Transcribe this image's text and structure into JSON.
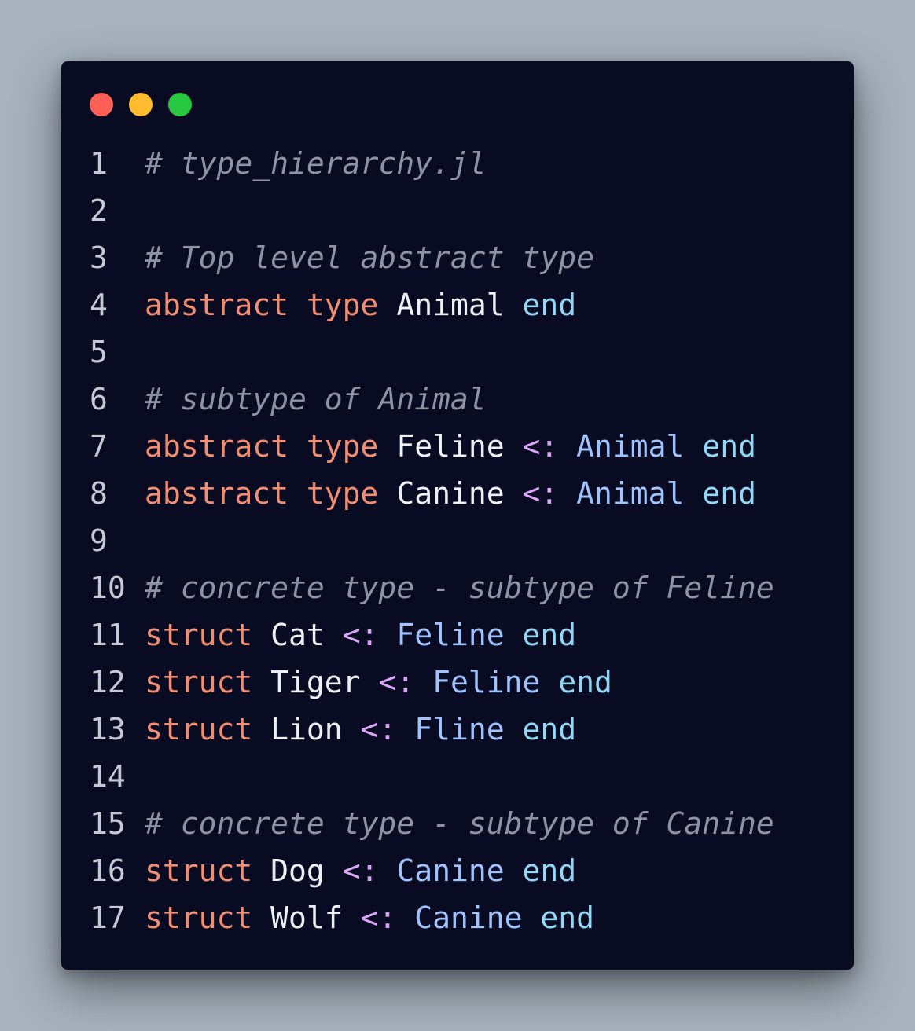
{
  "window": {
    "controls": [
      {
        "name": "close",
        "color": "#fe5f57"
      },
      {
        "name": "minimize",
        "color": "#febc2e"
      },
      {
        "name": "maximize",
        "color": "#28c840"
      }
    ]
  },
  "code": {
    "language": "julia",
    "lines": [
      {
        "number": "1",
        "tokens": [
          {
            "text": "# type_hierarchy.jl",
            "kind": "comment"
          }
        ]
      },
      {
        "number": "2",
        "tokens": []
      },
      {
        "number": "3",
        "tokens": [
          {
            "text": "# Top level abstract type",
            "kind": "comment"
          }
        ]
      },
      {
        "number": "4",
        "tokens": [
          {
            "text": "abstract type",
            "kind": "kw"
          },
          {
            "text": " ",
            "kind": "plain"
          },
          {
            "text": "Animal",
            "kind": "name"
          },
          {
            "text": " ",
            "kind": "plain"
          },
          {
            "text": "end",
            "kind": "end"
          }
        ]
      },
      {
        "number": "5",
        "tokens": []
      },
      {
        "number": "6",
        "tokens": [
          {
            "text": "# subtype of Animal",
            "kind": "comment"
          }
        ]
      },
      {
        "number": "7",
        "tokens": [
          {
            "text": "abstract type",
            "kind": "kw"
          },
          {
            "text": " ",
            "kind": "plain"
          },
          {
            "text": "Feline",
            "kind": "name"
          },
          {
            "text": " ",
            "kind": "plain"
          },
          {
            "text": "<:",
            "kind": "op"
          },
          {
            "text": " ",
            "kind": "plain"
          },
          {
            "text": "Animal",
            "kind": "type"
          },
          {
            "text": " ",
            "kind": "plain"
          },
          {
            "text": "end",
            "kind": "end"
          }
        ]
      },
      {
        "number": "8",
        "tokens": [
          {
            "text": "abstract type",
            "kind": "kw"
          },
          {
            "text": " ",
            "kind": "plain"
          },
          {
            "text": "Canine",
            "kind": "name"
          },
          {
            "text": " ",
            "kind": "plain"
          },
          {
            "text": "<:",
            "kind": "op"
          },
          {
            "text": " ",
            "kind": "plain"
          },
          {
            "text": "Animal",
            "kind": "type"
          },
          {
            "text": " ",
            "kind": "plain"
          },
          {
            "text": "end",
            "kind": "end"
          }
        ]
      },
      {
        "number": "9",
        "tokens": []
      },
      {
        "number": "10",
        "tokens": [
          {
            "text": "# concrete type - subtype of Feline",
            "kind": "comment"
          }
        ]
      },
      {
        "number": "11",
        "tokens": [
          {
            "text": "struct",
            "kind": "kw"
          },
          {
            "text": " ",
            "kind": "plain"
          },
          {
            "text": "Cat",
            "kind": "name"
          },
          {
            "text": " ",
            "kind": "plain"
          },
          {
            "text": "<:",
            "kind": "op"
          },
          {
            "text": " ",
            "kind": "plain"
          },
          {
            "text": "Feline",
            "kind": "type"
          },
          {
            "text": " ",
            "kind": "plain"
          },
          {
            "text": "end",
            "kind": "end"
          }
        ]
      },
      {
        "number": "12",
        "tokens": [
          {
            "text": "struct",
            "kind": "kw"
          },
          {
            "text": " ",
            "kind": "plain"
          },
          {
            "text": "Tiger",
            "kind": "name"
          },
          {
            "text": " ",
            "kind": "plain"
          },
          {
            "text": "<:",
            "kind": "op"
          },
          {
            "text": " ",
            "kind": "plain"
          },
          {
            "text": "Feline",
            "kind": "type"
          },
          {
            "text": " ",
            "kind": "plain"
          },
          {
            "text": "end",
            "kind": "end"
          }
        ]
      },
      {
        "number": "13",
        "tokens": [
          {
            "text": "struct",
            "kind": "kw"
          },
          {
            "text": " ",
            "kind": "plain"
          },
          {
            "text": "Lion",
            "kind": "name"
          },
          {
            "text": " ",
            "kind": "plain"
          },
          {
            "text": "<:",
            "kind": "op"
          },
          {
            "text": " ",
            "kind": "plain"
          },
          {
            "text": "Fline",
            "kind": "type"
          },
          {
            "text": " ",
            "kind": "plain"
          },
          {
            "text": "end",
            "kind": "end"
          }
        ]
      },
      {
        "number": "14",
        "tokens": []
      },
      {
        "number": "15",
        "tokens": [
          {
            "text": "# concrete type - subtype of Canine",
            "kind": "comment"
          }
        ]
      },
      {
        "number": "16",
        "tokens": [
          {
            "text": "struct",
            "kind": "kw"
          },
          {
            "text": " ",
            "kind": "plain"
          },
          {
            "text": "Dog",
            "kind": "name"
          },
          {
            "text": " ",
            "kind": "plain"
          },
          {
            "text": "<:",
            "kind": "op"
          },
          {
            "text": " ",
            "kind": "plain"
          },
          {
            "text": "Canine",
            "kind": "type"
          },
          {
            "text": " ",
            "kind": "plain"
          },
          {
            "text": "end",
            "kind": "end"
          }
        ]
      },
      {
        "number": "17",
        "tokens": [
          {
            "text": "struct",
            "kind": "kw"
          },
          {
            "text": " ",
            "kind": "plain"
          },
          {
            "text": "Wolf",
            "kind": "name"
          },
          {
            "text": " ",
            "kind": "plain"
          },
          {
            "text": "<:",
            "kind": "op"
          },
          {
            "text": " ",
            "kind": "plain"
          },
          {
            "text": "Canine",
            "kind": "type"
          },
          {
            "text": " ",
            "kind": "plain"
          },
          {
            "text": "end",
            "kind": "end"
          }
        ]
      }
    ]
  }
}
